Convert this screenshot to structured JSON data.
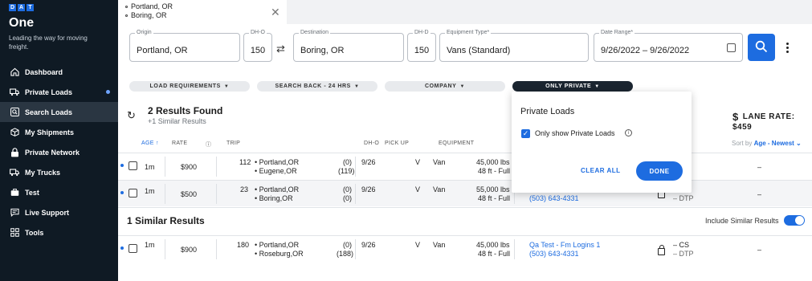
{
  "brand": {
    "logo_letters": [
      "D",
      "A",
      "T"
    ],
    "app_name": "One",
    "tagline": "Leading the way for moving freight.",
    "accent_color": "#1d6ce0",
    "sidebar_color": "#0f1a24"
  },
  "sidebar": {
    "items": [
      {
        "label": "Dashboard",
        "icon": "home-icon"
      },
      {
        "label": "Private Loads",
        "icon": "truck-icon"
      },
      {
        "label": "Search Loads",
        "icon": "search-icon"
      },
      {
        "label": "My Shipments",
        "icon": "box-icon"
      },
      {
        "label": "Private Network",
        "icon": "lock-icon"
      },
      {
        "label": "My Trucks",
        "icon": "truck-icon"
      },
      {
        "label": "Test",
        "icon": "briefcase-icon"
      },
      {
        "label": "Live Support",
        "icon": "chat-icon"
      },
      {
        "label": "Tools",
        "icon": "grid-icon"
      }
    ],
    "active_item": "Search Loads"
  },
  "tab": {
    "origin": "Portland, OR",
    "destination": "Boring, OR"
  },
  "search": {
    "origin_label": "Origin",
    "origin_value": "Portland, OR",
    "dho_label": "DH-O",
    "dho_value": "150",
    "destination_label": "Destination",
    "destination_value": "Boring, OR",
    "dhd_label": "DH-D",
    "dhd_value": "150",
    "equipment_label": "Equipment Type*",
    "equipment_value": "Vans (Standard)",
    "date_label": "Date Range*",
    "date_value": "9/26/2022 – 9/26/2022"
  },
  "filters": {
    "load_requirements": "LOAD REQUIREMENTS",
    "search_back": "SEARCH BACK - 24 HRS",
    "company": "COMPANY",
    "only_private": "ONLY PRIVATE"
  },
  "results": {
    "title": "2 Results Found",
    "similar_sub": "+1 Similar Results",
    "lane_rate": "LANE RATE: $459"
  },
  "columns": {
    "age": "AGE",
    "rate": "RATE",
    "trip": "TRIP",
    "dho": "DH-O",
    "pickup": "PICK UP",
    "equipment": "EQUIPMENT",
    "sort_prefix": "Sort by",
    "sort_value": "Age - Newest"
  },
  "rows": [
    {
      "age": "1m",
      "rate": "$900",
      "trip": "112",
      "origin": "Portland,OR",
      "dest": "Eugene,OR",
      "dh_o": "(0)",
      "dh_d": "(119)",
      "pickup": "9/26",
      "type": "V",
      "equipment": "Van",
      "weight": "45,000 lbs",
      "length": "48 ft - Full",
      "company": "",
      "phone": "",
      "cs": "",
      "dtp": "",
      "last": "–"
    },
    {
      "age": "1m",
      "rate": "$500",
      "trip": "23",
      "origin": "Portland,OR",
      "dest": "Boring,OR",
      "dh_o": "(0)",
      "dh_d": "(0)",
      "pickup": "9/26",
      "type": "V",
      "equipment": "Van",
      "weight": "55,000 lbs",
      "length": "48 ft - Full",
      "company": "",
      "phone": "(503) 643-4331",
      "cs": "",
      "dtp": "– DTP",
      "last": "–"
    }
  ],
  "similar": {
    "title": "1 Similar Results",
    "include_label": "Include Similar Results",
    "include_on": true,
    "rows": [
      {
        "age": "1m",
        "rate": "$900",
        "trip": "180",
        "origin": "Portland,OR",
        "dest": "Roseburg,OR",
        "dh_o": "(0)",
        "dh_d": "(188)",
        "pickup": "9/26",
        "type": "V",
        "equipment": "Van",
        "weight": "45,000 lbs",
        "length": "48 ft - Full",
        "company": "Qa Test - Fm Logins 1",
        "phone": "(503) 643-4331",
        "cs": "– CS",
        "dtp": "– DTP",
        "last": "–"
      }
    ]
  },
  "popover": {
    "title": "Private Loads",
    "checkbox_label": "Only show Private Loads",
    "checked": true,
    "clear_label": "CLEAR ALL",
    "done_label": "DONE"
  }
}
